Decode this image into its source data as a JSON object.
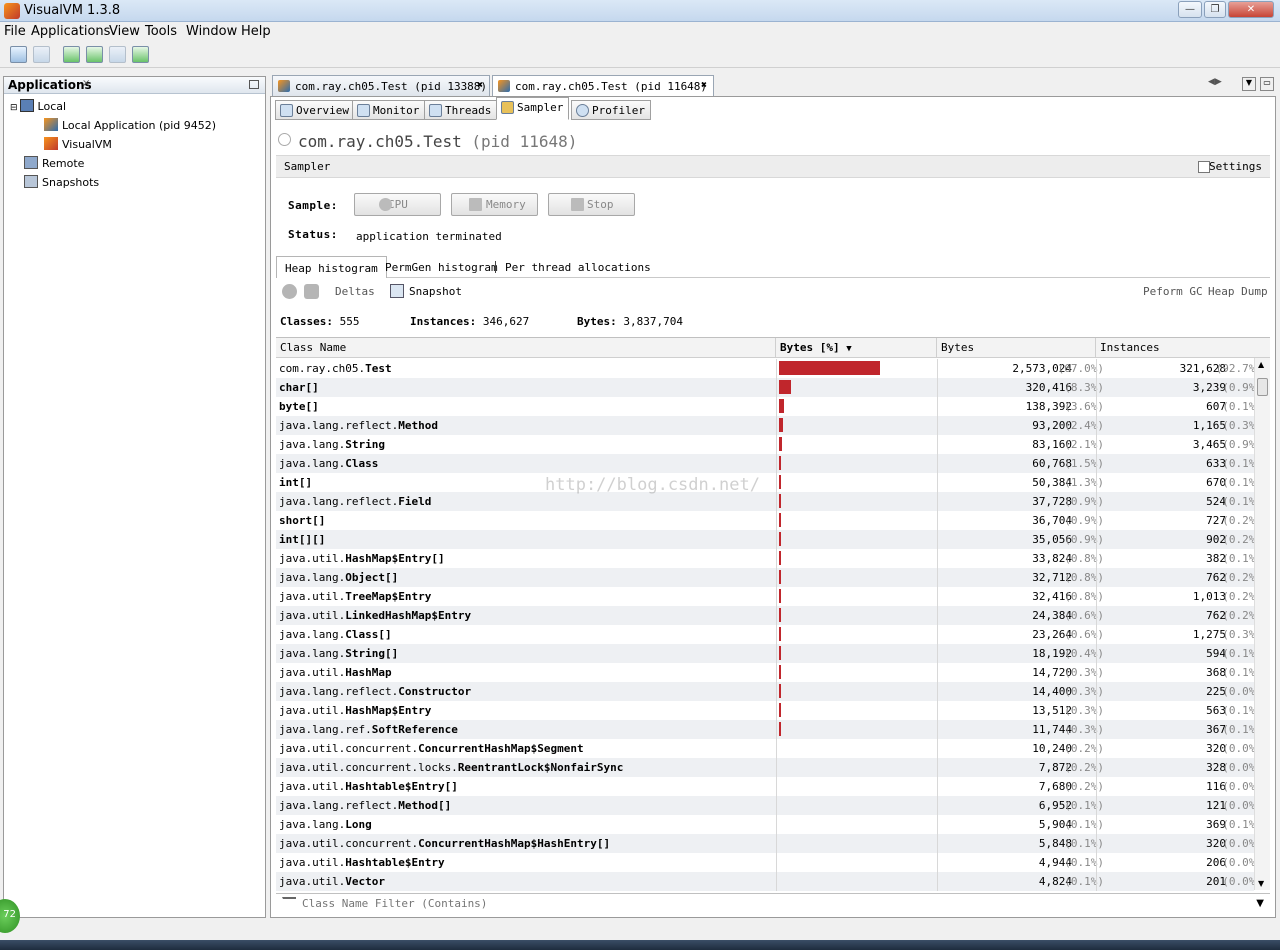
{
  "window": {
    "title": "VisualVM 1.3.8"
  },
  "menu": [
    "File",
    "Applications",
    "View",
    "Tools",
    "Window",
    "Help"
  ],
  "applications_panel": {
    "title": "Applications",
    "close": "×",
    "tree": {
      "local": "Local",
      "local_children": [
        "Local Application (pid 9452)",
        "VisualVM"
      ],
      "remote": "Remote",
      "snapshots": "Snapshots"
    }
  },
  "doc_tabs": [
    {
      "label": "com.ray.ch05.Test (pid 13388)",
      "active": false
    },
    {
      "label": "com.ray.ch05.Test (pid 11648)",
      "active": true
    }
  ],
  "view_tabs": [
    "Overview",
    "Monitor",
    "Threads",
    "Sampler",
    "Profiler"
  ],
  "process": {
    "name": "com.ray.ch05.Test",
    "pid": "(pid 11648)"
  },
  "sampler": {
    "title": "Sampler",
    "settings_label": "Settings",
    "sample_label": "Sample:",
    "status_label": "Status:",
    "status_value": "application terminated",
    "buttons": {
      "cpu": "CPU",
      "memory": "Memory",
      "stop": "Stop"
    }
  },
  "hist_tabs": [
    "Heap histogram",
    "PermGen histogram",
    "Per thread allocations"
  ],
  "hist_toolbar": {
    "deltas": "Deltas",
    "snapshot": "Snapshot",
    "gc": "Peform GC",
    "heap_dump": "Heap Dump"
  },
  "summary": {
    "classes_label": "Classes:",
    "classes": "555",
    "instances_label": "Instances:",
    "instances": "346,627",
    "bytes_label": "Bytes:",
    "bytes": "3,837,704"
  },
  "columns": {
    "class_name": "Class Name",
    "bytes_pct": "Bytes [%]",
    "bytes": "Bytes",
    "instances": "Instances"
  },
  "rows": [
    {
      "pkg": "com.ray.ch05.",
      "cls": "Test",
      "bytes": "2,573,024",
      "bpct": "(67.0%)",
      "inst": "321,628",
      "ipct": "(92.7%)",
      "share": 67.0
    },
    {
      "pkg": "",
      "cls": "char[]",
      "bytes": "320,416",
      "bpct": "(8.3%)",
      "inst": "3,239",
      "ipct": "(0.9%)",
      "share": 8.3
    },
    {
      "pkg": "",
      "cls": "byte[]",
      "bytes": "138,392",
      "bpct": "(3.6%)",
      "inst": "607",
      "ipct": "(0.1%)",
      "share": 3.6
    },
    {
      "pkg": "java.lang.reflect.",
      "cls": "Method",
      "bytes": "93,200",
      "bpct": "(2.4%)",
      "inst": "1,165",
      "ipct": "(0.3%)",
      "share": 2.4
    },
    {
      "pkg": "java.lang.",
      "cls": "String",
      "bytes": "83,160",
      "bpct": "(2.1%)",
      "inst": "3,465",
      "ipct": "(0.9%)",
      "share": 2.1
    },
    {
      "pkg": "java.lang.",
      "cls": "Class",
      "bytes": "60,768",
      "bpct": "(1.5%)",
      "inst": "633",
      "ipct": "(0.1%)",
      "share": 1.5
    },
    {
      "pkg": "",
      "cls": "int[]",
      "bytes": "50,384",
      "bpct": "(1.3%)",
      "inst": "670",
      "ipct": "(0.1%)",
      "share": 1.3
    },
    {
      "pkg": "java.lang.reflect.",
      "cls": "Field",
      "bytes": "37,728",
      "bpct": "(0.9%)",
      "inst": "524",
      "ipct": "(0.1%)",
      "share": 0.9
    },
    {
      "pkg": "",
      "cls": "short[]",
      "bytes": "36,704",
      "bpct": "(0.9%)",
      "inst": "727",
      "ipct": "(0.2%)",
      "share": 0.9
    },
    {
      "pkg": "",
      "cls": "int[][]",
      "bytes": "35,056",
      "bpct": "(0.9%)",
      "inst": "902",
      "ipct": "(0.2%)",
      "share": 0.9
    },
    {
      "pkg": "java.util.",
      "cls": "HashMap$Entry[]",
      "bytes": "33,824",
      "bpct": "(0.8%)",
      "inst": "382",
      "ipct": "(0.1%)",
      "share": 0.8
    },
    {
      "pkg": "java.lang.",
      "cls": "Object[]",
      "bytes": "32,712",
      "bpct": "(0.8%)",
      "inst": "762",
      "ipct": "(0.2%)",
      "share": 0.8
    },
    {
      "pkg": "java.util.",
      "cls": "TreeMap$Entry",
      "bytes": "32,416",
      "bpct": "(0.8%)",
      "inst": "1,013",
      "ipct": "(0.2%)",
      "share": 0.8
    },
    {
      "pkg": "java.util.",
      "cls": "LinkedHashMap$Entry",
      "bytes": "24,384",
      "bpct": "(0.6%)",
      "inst": "762",
      "ipct": "(0.2%)",
      "share": 0.6
    },
    {
      "pkg": "java.lang.",
      "cls": "Class[]",
      "bytes": "23,264",
      "bpct": "(0.6%)",
      "inst": "1,275",
      "ipct": "(0.3%)",
      "share": 0.6
    },
    {
      "pkg": "java.lang.",
      "cls": "String[]",
      "bytes": "18,192",
      "bpct": "(0.4%)",
      "inst": "594",
      "ipct": "(0.1%)",
      "share": 0.4
    },
    {
      "pkg": "java.util.",
      "cls": "HashMap",
      "bytes": "14,720",
      "bpct": "(0.3%)",
      "inst": "368",
      "ipct": "(0.1%)",
      "share": 0.3
    },
    {
      "pkg": "java.lang.reflect.",
      "cls": "Constructor",
      "bytes": "14,400",
      "bpct": "(0.3%)",
      "inst": "225",
      "ipct": "(0.0%)",
      "share": 0.3
    },
    {
      "pkg": "java.util.",
      "cls": "HashMap$Entry",
      "bytes": "13,512",
      "bpct": "(0.3%)",
      "inst": "563",
      "ipct": "(0.1%)",
      "share": 0.3
    },
    {
      "pkg": "java.lang.ref.",
      "cls": "SoftReference",
      "bytes": "11,744",
      "bpct": "(0.3%)",
      "inst": "367",
      "ipct": "(0.1%)",
      "share": 0.3
    },
    {
      "pkg": "java.util.concurrent.",
      "cls": "ConcurrentHashMap$Segment",
      "bytes": "10,240",
      "bpct": "(0.2%)",
      "inst": "320",
      "ipct": "(0.0%)",
      "share": 0.2
    },
    {
      "pkg": "java.util.concurrent.locks.",
      "cls": "ReentrantLock$NonfairSync",
      "bytes": "7,872",
      "bpct": "(0.2%)",
      "inst": "328",
      "ipct": "(0.0%)",
      "share": 0.2
    },
    {
      "pkg": "java.util.",
      "cls": "Hashtable$Entry[]",
      "bytes": "7,680",
      "bpct": "(0.2%)",
      "inst": "116",
      "ipct": "(0.0%)",
      "share": 0.2
    },
    {
      "pkg": "java.lang.reflect.",
      "cls": "Method[]",
      "bytes": "6,952",
      "bpct": "(0.1%)",
      "inst": "121",
      "ipct": "(0.0%)",
      "share": 0.1
    },
    {
      "pkg": "java.lang.",
      "cls": "Long",
      "bytes": "5,904",
      "bpct": "(0.1%)",
      "inst": "369",
      "ipct": "(0.1%)",
      "share": 0.1
    },
    {
      "pkg": "java.util.concurrent.",
      "cls": "ConcurrentHashMap$HashEntry[]",
      "bytes": "5,848",
      "bpct": "(0.1%)",
      "inst": "320",
      "ipct": "(0.0%)",
      "share": 0.1
    },
    {
      "pkg": "java.util.",
      "cls": "Hashtable$Entry",
      "bytes": "4,944",
      "bpct": "(0.1%)",
      "inst": "206",
      "ipct": "(0.0%)",
      "share": 0.1
    },
    {
      "pkg": "java.util.",
      "cls": "Vector",
      "bytes": "4,824",
      "bpct": "(0.1%)",
      "inst": "201",
      "ipct": "(0.0%)",
      "share": 0.1
    }
  ],
  "filter": {
    "placeholder": "Class Name Filter (Contains)"
  },
  "watermark": "http://blog.csdn.net/",
  "badge": "72",
  "colors": {
    "bar": "#c0262c",
    "accent": "#c5d8ee"
  }
}
